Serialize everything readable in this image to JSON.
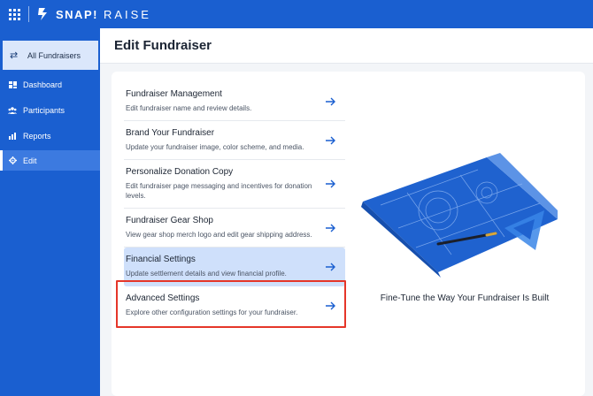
{
  "app": {
    "brand_name": "SNAP!",
    "brand_sub": "RAISE"
  },
  "sidebar": {
    "all_fundraisers": "All Fundraisers",
    "items": [
      {
        "label": "Dashboard",
        "icon": "dashboard-icon"
      },
      {
        "label": "Participants",
        "icon": "participants-icon"
      },
      {
        "label": "Reports",
        "icon": "reports-icon"
      },
      {
        "label": "Edit",
        "icon": "gear-icon",
        "active": true
      }
    ]
  },
  "header": {
    "title": "Edit Fundraiser"
  },
  "settings": [
    {
      "title": "Fundraiser Management",
      "description": "Edit fundraiser name and review details."
    },
    {
      "title": "Brand Your Fundraiser",
      "description": "Update your fundraiser image, color scheme, and media."
    },
    {
      "title": "Personalize Donation Copy",
      "description": "Edit fundraiser page messaging and incentives for donation levels."
    },
    {
      "title": "Fundraiser Gear Shop",
      "description": "View gear shop merch logo and edit gear shipping address."
    },
    {
      "title": "Financial Settings",
      "description": "Update settlement details and view financial profile.",
      "selected": true
    },
    {
      "title": "Advanced Settings",
      "description": "Explore other configuration settings for your fundraiser."
    }
  ],
  "illustration": {
    "caption": "Fine-Tune the Way Your Fundraiser Is Built"
  },
  "colors": {
    "brand_blue": "#1a5fd0",
    "selected_bg": "#cfe0fb",
    "highlight_red": "#e53629",
    "arrow_blue": "#1a5fd0"
  }
}
